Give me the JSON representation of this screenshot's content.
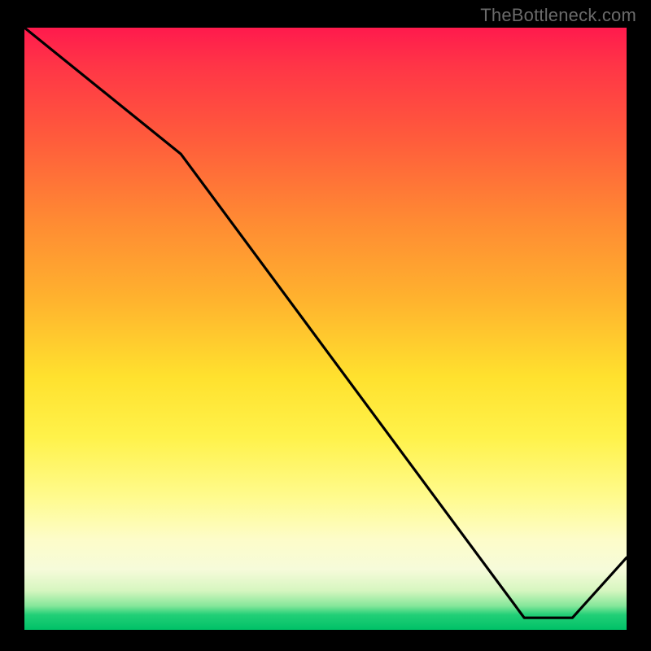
{
  "attribution": "TheBottleneck.com",
  "small_label": "",
  "chart_data": {
    "type": "line",
    "title": "",
    "xlabel": "",
    "ylabel": "",
    "xlim": [
      0,
      100
    ],
    "ylim": [
      0,
      100
    ],
    "x": [
      0,
      26,
      83,
      91,
      100
    ],
    "values": [
      100,
      79,
      2,
      2,
      12
    ],
    "annotations": [
      {
        "text": "",
        "x": 85,
        "y": 3
      }
    ]
  },
  "colors": {
    "curve": "#000000",
    "label": "#c0392b",
    "attribution": "#6a6a6a",
    "border": "#000000"
  }
}
